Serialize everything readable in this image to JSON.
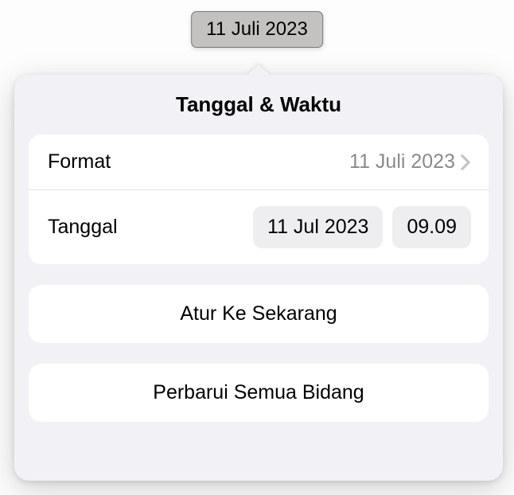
{
  "chip": {
    "text": "11 Juli 2023"
  },
  "popover": {
    "title": "Tanggal & Waktu",
    "format": {
      "label": "Format",
      "value": "11 Juli 2023"
    },
    "date": {
      "label": "Tanggal",
      "date_value": "11 Jul 2023",
      "time_value": "09.09"
    },
    "actions": {
      "set_now": "Atur Ke Sekarang",
      "update_all": "Perbarui Semua Bidang"
    }
  },
  "colors": {
    "chip_bg": "#c4c2c0",
    "popover_bg": "#f2f2f6",
    "card_bg": "#ffffff",
    "pill_bg": "#eeeef0",
    "secondary_text": "#8a8a8e"
  }
}
